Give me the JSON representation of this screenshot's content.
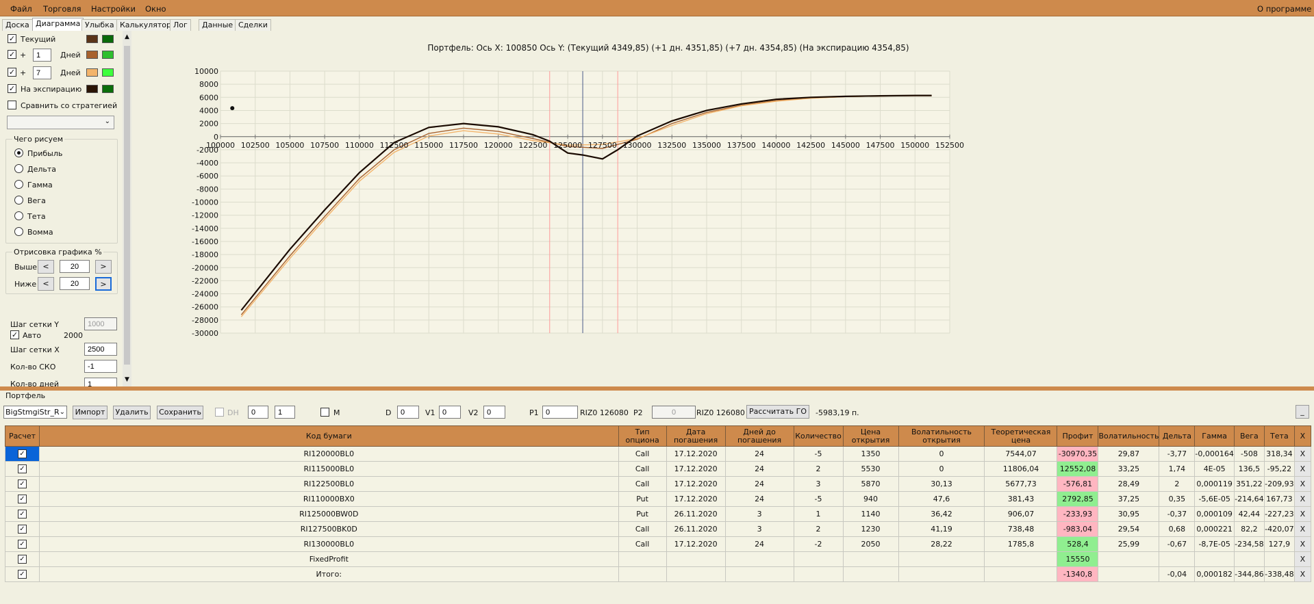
{
  "menu": {
    "file": "Файл",
    "trade": "Торговля",
    "settings": "Настройки",
    "window": "Окно",
    "about": "О программе"
  },
  "tabs": [
    "Доска",
    "Диаграмма",
    "Улыбка",
    "Калькулятор",
    "Лог",
    "Данные",
    "Сделки"
  ],
  "left": {
    "current": "Текущий",
    "plus": "+",
    "days": "Дней",
    "days1": "1",
    "days2": "7",
    "expiration": "На экспирацию",
    "compare": "Сравнить со стратегией",
    "draw_group": "Чего рисуем",
    "modes": [
      "Прибыль",
      "Дельта",
      "Гамма",
      "Вега",
      "Тета",
      "Вомма"
    ],
    "render_group": "Отрисовка графика %",
    "above": "Выше",
    "below": "Ниже",
    "above_val": "20",
    "below_val": "20",
    "lt": "<",
    "gt": ">",
    "grid_y": "Шаг сетки Y",
    "grid_y_val": "1000",
    "auto": "Авто",
    "auto_val": "2000",
    "grid_x": "Шаг сетки X",
    "grid_x_val": "2500",
    "sko": "Кол-во СКО",
    "sko_val": "-1",
    "days_count": "Кол-во дней",
    "days_count_val": "1",
    "colors": {
      "cur1": "#5a3418",
      "cur2": "#0a6a0a",
      "d1a": "#a8622e",
      "d1b": "#2fbf2f",
      "d7a": "#f3b46b",
      "d7b": "#3dff3d",
      "exa": "#2a1405",
      "exb": "#0b6e0b"
    }
  },
  "chart_data": {
    "type": "line",
    "title": "Портфель: Ось X: 100850 Ось Y: (Текущий 4349,85) (+1 дн. 4351,85) (+7 дн. 4354,85) (На экспирацию 4354,85)",
    "xlim": [
      100000,
      152500
    ],
    "ylim": [
      -30000,
      10000
    ],
    "xticks": [
      "100000",
      "102500",
      "105000",
      "107500",
      "110000",
      "112500",
      "115000",
      "117500",
      "120000",
      "122500",
      "125000",
      "127500",
      "130000",
      "132500",
      "135000",
      "137500",
      "140000",
      "142500",
      "145000",
      "147500",
      "150000",
      "152500"
    ],
    "yticks": [
      "10000",
      "8000",
      "6000",
      "4000",
      "2000",
      "0",
      "-2000",
      "-4000",
      "-6000",
      "-8000",
      "-10000",
      "-12000",
      "-14000",
      "-16000",
      "-18000",
      "-20000",
      "-22000",
      "-24000",
      "-26000",
      "-28000",
      "-30000"
    ],
    "vlines": [
      {
        "x": 123700,
        "color": "#ff9a9a"
      },
      {
        "x": 126080,
        "color": "#4a5a8a"
      },
      {
        "x": 128600,
        "color": "#ff9a9a"
      }
    ],
    "point": {
      "x": 100850,
      "y": 4350
    },
    "series": [
      {
        "color": "#a8622e",
        "points": [
          [
            101500,
            -27200
          ],
          [
            105000,
            -18200
          ],
          [
            107500,
            -12200
          ],
          [
            110000,
            -6400
          ],
          [
            112500,
            -2000
          ],
          [
            115000,
            500
          ],
          [
            117500,
            1300
          ],
          [
            120000,
            800
          ],
          [
            122500,
            -300
          ],
          [
            125000,
            -1500
          ],
          [
            127500,
            -1800
          ],
          [
            130000,
            -400
          ],
          [
            132500,
            2000
          ],
          [
            135000,
            3700
          ],
          [
            137500,
            4800
          ],
          [
            140000,
            5500
          ],
          [
            142500,
            5900
          ],
          [
            145000,
            6100
          ],
          [
            147500,
            6200
          ],
          [
            150000,
            6250
          ],
          [
            151200,
            6250
          ]
        ]
      },
      {
        "color": "#f3b46b",
        "points": [
          [
            101500,
            -27500
          ],
          [
            105000,
            -18600
          ],
          [
            107500,
            -12600
          ],
          [
            110000,
            -6800
          ],
          [
            112500,
            -2400
          ],
          [
            115000,
            100
          ],
          [
            117500,
            900
          ],
          [
            120000,
            400
          ],
          [
            122500,
            -600
          ],
          [
            125000,
            -1300
          ],
          [
            127500,
            -1200
          ],
          [
            130000,
            -300
          ],
          [
            132500,
            1700
          ],
          [
            135000,
            3500
          ],
          [
            137500,
            4700
          ],
          [
            140000,
            5400
          ],
          [
            142500,
            5850
          ],
          [
            145000,
            6100
          ],
          [
            147500,
            6200
          ],
          [
            150000,
            6250
          ],
          [
            151200,
            6250
          ]
        ]
      },
      {
        "color": "#1a0a00",
        "points": [
          [
            101500,
            -26500
          ],
          [
            105000,
            -17200
          ],
          [
            107500,
            -11200
          ],
          [
            110000,
            -5500
          ],
          [
            112500,
            -900
          ],
          [
            115000,
            1400
          ],
          [
            117500,
            2000
          ],
          [
            120000,
            1500
          ],
          [
            122500,
            300
          ],
          [
            123700,
            -700
          ],
          [
            125000,
            -2500
          ],
          [
            126080,
            -2800
          ],
          [
            127500,
            -3400
          ],
          [
            128600,
            -2000
          ],
          [
            130000,
            100
          ],
          [
            132500,
            2400
          ],
          [
            135000,
            4000
          ],
          [
            137500,
            5000
          ],
          [
            140000,
            5700
          ],
          [
            142500,
            6000
          ],
          [
            145000,
            6150
          ],
          [
            147500,
            6230
          ],
          [
            150000,
            6280
          ],
          [
            151200,
            6280
          ]
        ]
      }
    ]
  },
  "portfolio": {
    "title": "Портфель",
    "strategy": "BigStmgiStr_R",
    "import": "Импорт",
    "delete": "Удалить",
    "save": "Сохранить",
    "dh": "DH",
    "sp1": "0",
    "sp2": "1",
    "m": "M",
    "d": "D",
    "d_val": "0",
    "v1": "V1",
    "v1_val": "0",
    "v2": "V2",
    "v2_val": "0",
    "p1": "P1",
    "p1_val": "0",
    "riz1": "RIZ0 126080",
    "p2": "P2",
    "p2_val": "0",
    "riz2": "RIZ0 126080",
    "calc_go": "Рассчитать ГО",
    "go_val": "-5983,19 п.",
    "min": "_"
  },
  "table": {
    "headers": [
      "Расчет",
      "Код бумаги",
      "Тип опциона",
      "Дата погашения",
      "Дней до погашения",
      "Количество",
      "Цена открытия",
      "Волатильность открытия",
      "Теоретическая цена",
      "Профит",
      "Волатильность",
      "Дельта",
      "Гамма",
      "Вега",
      "Тета",
      "X"
    ],
    "rows": [
      [
        "RI120000BL0",
        "Call",
        "17.12.2020",
        "24",
        "-5",
        "1350",
        "0",
        "7544,07",
        "-30970,35",
        "29,87",
        "-3,77",
        "-0,000164",
        "-508",
        "318,34",
        "X"
      ],
      [
        "RI115000BL0",
        "Call",
        "17.12.2020",
        "24",
        "2",
        "5530",
        "0",
        "11806,04",
        "12552,08",
        "33,25",
        "1,74",
        "4E-05",
        "136,5",
        "-95,22",
        "X"
      ],
      [
        "RI122500BL0",
        "Call",
        "17.12.2020",
        "24",
        "3",
        "5870",
        "30,13",
        "5677,73",
        "-576,81",
        "28,49",
        "2",
        "0,000119",
        "351,22",
        "-209,93",
        "X"
      ],
      [
        "RI110000BX0",
        "Put",
        "17.12.2020",
        "24",
        "-5",
        "940",
        "47,6",
        "381,43",
        "2792,85",
        "37,25",
        "0,35",
        "-5,6E-05",
        "-214,64",
        "167,73",
        "X"
      ],
      [
        "RI125000BW0D",
        "Put",
        "26.11.2020",
        "3",
        "1",
        "1140",
        "36,42",
        "906,07",
        "-233,93",
        "30,95",
        "-0,37",
        "0,000109",
        "42,44",
        "-227,23",
        "X"
      ],
      [
        "RI127500BK0D",
        "Call",
        "26.11.2020",
        "3",
        "2",
        "1230",
        "41,19",
        "738,48",
        "-983,04",
        "29,54",
        "0,68",
        "0,000221",
        "82,2",
        "-420,07",
        "X"
      ],
      [
        "RI130000BL0",
        "Call",
        "17.12.2020",
        "24",
        "-2",
        "2050",
        "28,22",
        "1785,8",
        "528,4",
        "25,99",
        "-0,67",
        "-8,7E-05",
        "-234,58",
        "127,9",
        "X"
      ],
      [
        "FixedProfit",
        "",
        "",
        "",
        "",
        "",
        "",
        "",
        "15550",
        "",
        "",
        "",
        "",
        "",
        "X"
      ],
      [
        "Итого:",
        "",
        "",
        "",
        "",
        "",
        "",
        "",
        "-1340,8",
        "",
        "-0,04",
        "0,000182",
        "-344,86",
        "-338,48",
        "X"
      ]
    ],
    "profit_sign": [
      "neg",
      "pos",
      "neg",
      "pos",
      "neg",
      "neg",
      "pos",
      "pos",
      "neg"
    ]
  }
}
